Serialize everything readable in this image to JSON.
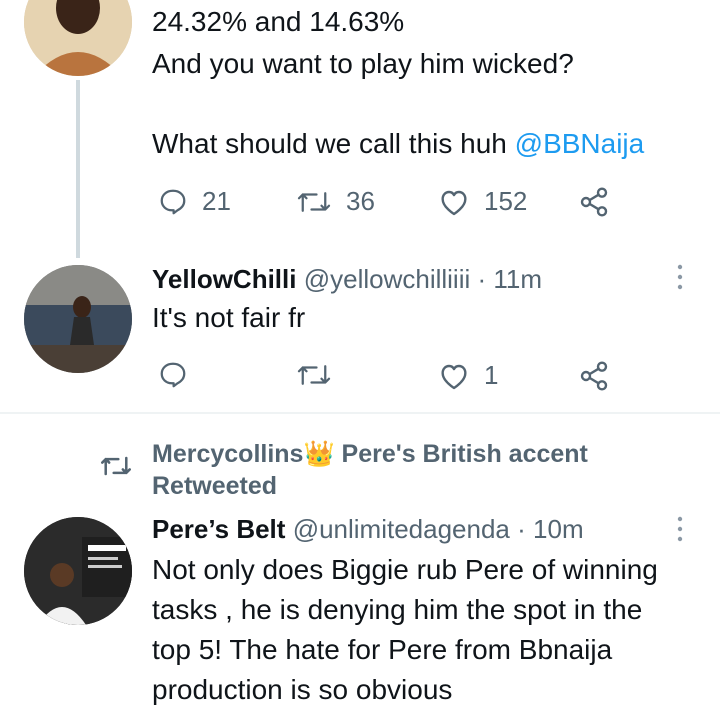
{
  "tweet1": {
    "lines": [
      "24.32% and 14.63%",
      "And you want to play him wicked?",
      "",
      "What should we call this huh "
    ],
    "mention": "@BBNaija",
    "replies": "21",
    "retweets": "36",
    "likes": "152"
  },
  "tweet2": {
    "name": "YellowChilli",
    "handle": "@yellowchilliiii",
    "time": "· 11m",
    "text": "It's not fair fr",
    "replies": "",
    "retweets": "",
    "likes": "1"
  },
  "retweet_context": {
    "line1": "Mercycollins",
    "crown": "👑",
    "line1b": " Pere's British accent",
    "line2": "Retweeted"
  },
  "tweet3": {
    "name": "Pere’s Belt",
    "handle": "@unlimitedagenda",
    "time": "· 10m",
    "lines": [
      "Not only does Biggie rub Pere of winning",
      "tasks , he is denying him the spot in the",
      "top 5! The hate for Pere from Bbnaija",
      "production is so obvious"
    ]
  },
  "colors": {
    "text": "#0f1419",
    "secondary": "#536471",
    "link": "#1d9bf0",
    "divider": "#eff3f4"
  },
  "icons": [
    "reply-icon",
    "retweet-icon",
    "like-icon",
    "share-icon",
    "more-icon"
  ]
}
